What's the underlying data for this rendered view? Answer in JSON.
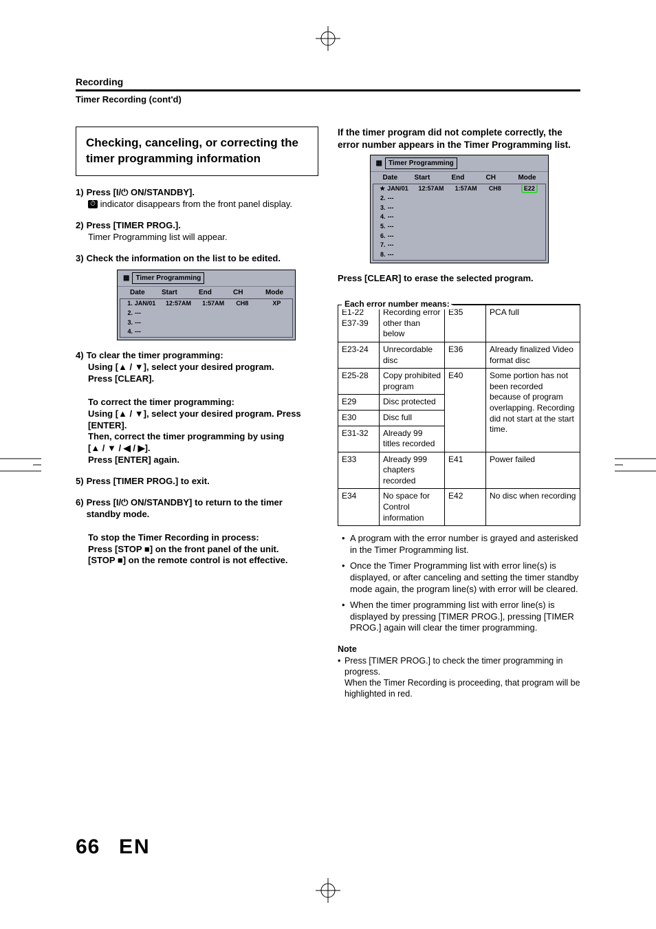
{
  "header": {
    "section": "Recording",
    "subsection": "Timer Recording (cont'd)"
  },
  "left": {
    "title": "Checking, canceling, or correcting the timer programming information",
    "steps": {
      "s1_head": "Press [I/⏻ ON/STANDBY].",
      "s1_body": " indicator disappears from the front panel display.",
      "s2_head": "Press [TIMER PROG.].",
      "s2_body": "Timer Programming list will appear.",
      "s3_head": "Check the information on the list to be edited.",
      "s4_head": "To clear the timer programming:",
      "s4_l1": "Using [▲ / ▼], select your desired program.",
      "s4_l2": "Press [CLEAR].",
      "s4_correct_head": "To correct the timer programming:",
      "s4_correct_l1": "Using [▲ / ▼], select your desired program. Press [ENTER].",
      "s4_correct_l2": "Then, correct the timer programming by using",
      "s4_correct_l3": "[▲ / ▼ / ◀ / ▶].",
      "s4_correct_l4": "Press [ENTER] again.",
      "s5_head": "Press [TIMER PROG.] to exit.",
      "s6_head": "Press [I/⏻ ON/STANDBY] to return to the timer standby mode.",
      "stop_head": "To stop the Timer Recording in process:",
      "stop_l1": "Press [STOP ■] on the front panel of the unit.",
      "stop_l2": "[STOP ■] on the remote control is not effective."
    },
    "timer_panel": {
      "title": "Timer Programming",
      "cols": {
        "c1": "Date",
        "c2": "Start",
        "c3": "End",
        "c4": "CH",
        "c5": "Mode"
      },
      "rows": [
        {
          "n": "1.",
          "date": "JAN/01",
          "start": "12:57AM",
          "end": "1:57AM",
          "ch": "CH8",
          "mode": "XP"
        },
        {
          "n": "2.",
          "date": "---"
        },
        {
          "n": "3.",
          "date": "---"
        },
        {
          "n": "4.",
          "date": "---"
        }
      ]
    }
  },
  "right": {
    "intro": "If the timer program did not complete correctly, the error number appears in the Timer Programming list.",
    "timer_panel": {
      "title": "Timer Programming",
      "cols": {
        "c1": "Date",
        "c2": "Start",
        "c3": "End",
        "c4": "CH",
        "c5": "Mode"
      },
      "rows": [
        {
          "n": "★",
          "date": "JAN/01",
          "start": "12:57AM",
          "end": "1:57AM",
          "ch": "CH8",
          "mode": "E22"
        },
        {
          "n": "2.",
          "date": "---"
        },
        {
          "n": "3.",
          "date": "---"
        },
        {
          "n": "4.",
          "date": "---"
        },
        {
          "n": "5.",
          "date": "---"
        },
        {
          "n": "6.",
          "date": "---"
        },
        {
          "n": "7.",
          "date": "---"
        },
        {
          "n": "8.",
          "date": "---"
        }
      ]
    },
    "press_clear": "Press [CLEAR] to erase the selected program.",
    "error_label": "Each error number means:",
    "errors": [
      {
        "c": "E1-22\nE37-39",
        "d": "Recording error other than below",
        "c2": "E35",
        "d2": "PCA full"
      },
      {
        "c": "E23-24",
        "d": "Unrecordable disc",
        "c2": "E36",
        "d2": "Already finalized Video format disc"
      },
      {
        "c": "E25-28",
        "d": "Copy prohibited program",
        "c2": "E40",
        "d2": "Some portion has not been recorded because of program overlapping. Recording did not start at the start time."
      },
      {
        "c": "E29",
        "d": "Disc protected"
      },
      {
        "c": "E30",
        "d": "Disc full"
      },
      {
        "c": "E31-32",
        "d": "Already 99 titles recorded"
      },
      {
        "c": "E33",
        "d": "Already 999 chapters recorded",
        "c2": "E41",
        "d2": "Power failed"
      },
      {
        "c": "E34",
        "d": "No space for Control information",
        "c2": "E42",
        "d2": "No disc when recording"
      }
    ],
    "notes": [
      "A program with the error number is grayed and asterisked in the Timer Programming list.",
      "Once the Timer Programming list with error line(s) is displayed, or after canceling and setting the timer standby mode again, the program line(s) with error will be cleared.",
      "When the timer programming list with error line(s) is displayed by pressing [TIMER PROG.], pressing [TIMER PROG.] again will clear the timer programming."
    ],
    "note_head": "Note",
    "note_body1": "Press [TIMER PROG.] to check the timer programming in progress.",
    "note_body2": "When the Timer Recording is proceeding, that program will be highlighted in red."
  },
  "footer": {
    "page": "66",
    "lang": "EN"
  }
}
